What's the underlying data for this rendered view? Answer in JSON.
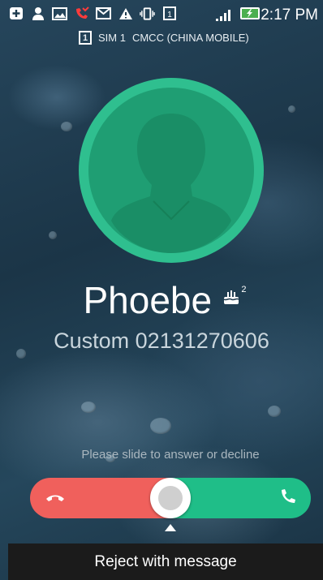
{
  "status_bar": {
    "time": "2:17 PM",
    "icons": [
      "plus-box-icon",
      "person-icon",
      "image-icon",
      "missed-call-icon",
      "gmail-icon",
      "warning-icon",
      "vibrate-icon",
      "sim-icon",
      "signal-icon",
      "battery-charging-icon"
    ]
  },
  "sim": {
    "badge": "1",
    "label": "SIM 1",
    "carrier": "CMCC (CHINA  MOBILE)"
  },
  "caller": {
    "name": "Phoebe",
    "badge_count": "2",
    "number": "Custom 02131270606"
  },
  "slider": {
    "hint": "Please slide to answer or decline"
  },
  "bottom": {
    "reject_label": "Reject with message"
  },
  "colors": {
    "decline": "#f0605c",
    "answer": "#1fbe88",
    "avatar": "#2fbf8f"
  }
}
